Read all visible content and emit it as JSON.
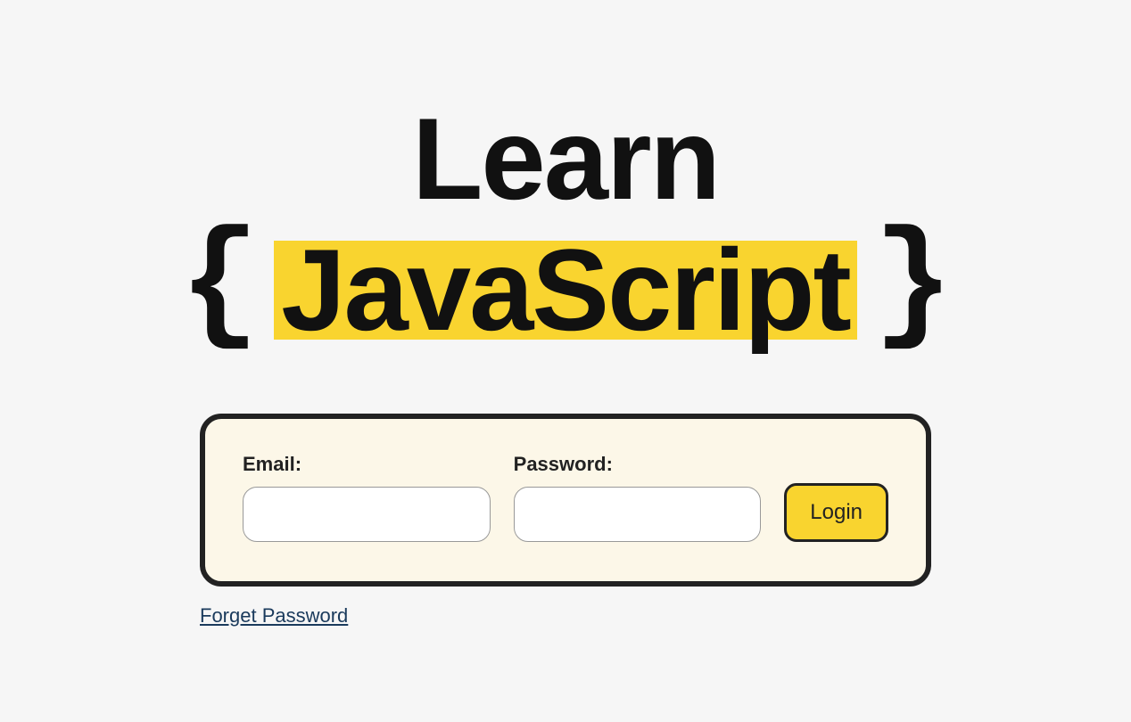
{
  "title": {
    "line1": "Learn",
    "brace_open": "{",
    "highlighted": "JavaScript",
    "brace_close": "}"
  },
  "form": {
    "email_label": "Email:",
    "email_value": "",
    "password_label": "Password:",
    "password_value": "",
    "login_button": "Login"
  },
  "links": {
    "forget_password": "Forget Password"
  },
  "colors": {
    "highlight": "#f9d42f",
    "card_bg": "#fcf7e8",
    "border": "#222222",
    "page_bg": "#f6f6f6",
    "link": "#1a3a5c"
  }
}
